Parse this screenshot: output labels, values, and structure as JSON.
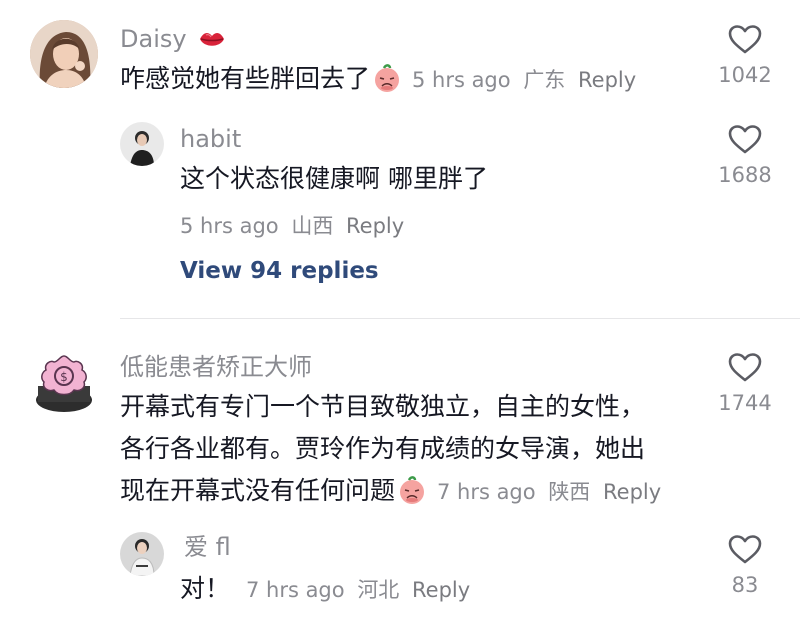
{
  "comments": [
    {
      "username": "Daisy",
      "badge_icon": "lips-icon",
      "text": "咋感觉她有些胖回去了",
      "text_emoji": "peach-face-icon",
      "time": "5 hrs ago",
      "location": "广东",
      "reply_label": "Reply",
      "likes": "1042"
    },
    {
      "username": "habit",
      "text": "这个状态很健康啊 哪里胖了",
      "time": "5 hrs ago",
      "location": "山西",
      "reply_label": "Reply",
      "likes": "1688"
    },
    {
      "username": "低能患者矫正大师",
      "text_line1": "开幕式有专门一个节目致敬独立，自主的女性，",
      "text_line2": "各行各业都有。贾玲作为有成绩的女导演，她出",
      "text_line3": "现在开幕式没有任何问题",
      "text_emoji": "peach-face-icon",
      "time": "7 hrs ago",
      "location": "陕西",
      "reply_label": "Reply",
      "likes": "1744"
    },
    {
      "username": "爱 fl",
      "text": "对！",
      "time": "7 hrs ago",
      "location": "河北",
      "reply_label": "Reply",
      "likes": "83"
    }
  ],
  "view_replies_label": "View 94 replies",
  "colors": {
    "username": "#8a8b91",
    "text": "#161823",
    "link": "#2f4a7a",
    "divider": "#e6e6e8"
  }
}
